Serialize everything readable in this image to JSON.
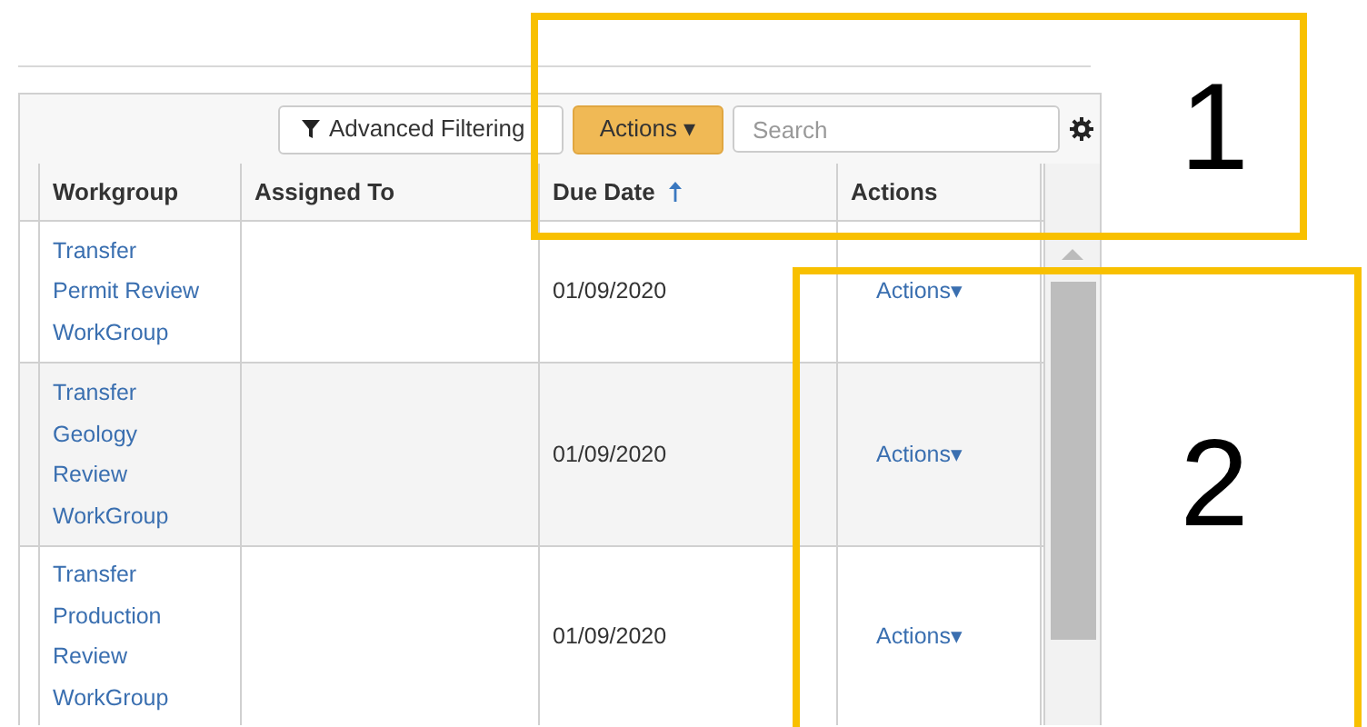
{
  "toolbar": {
    "filter_button": "Advanced Filtering",
    "actions_button": "Actions ▾",
    "search": {
      "placeholder": "Search"
    }
  },
  "table": {
    "columns": [
      {
        "label": "Workgroup",
        "sorted": false
      },
      {
        "label": "Assigned To",
        "sorted": false
      },
      {
        "label": "Due Date",
        "sorted": true
      },
      {
        "label": "Actions",
        "sorted": false
      }
    ],
    "rows": [
      {
        "workgroup": [
          "Transfer",
          "Permit Review",
          "WorkGroup"
        ],
        "due_date": "01/09/2020",
        "action": "Actions▾"
      },
      {
        "workgroup": [
          "Transfer",
          "Geology",
          "Review",
          "WorkGroup"
        ],
        "due_date": "01/09/2020",
        "action": "Actions▾"
      },
      {
        "workgroup": [
          "Transfer",
          "Production",
          "Review",
          "WorkGroup"
        ],
        "due_date": "01/09/2020",
        "action": "Actions▾"
      }
    ]
  },
  "annotations": [
    {
      "label": "1"
    },
    {
      "label": "2"
    }
  ]
}
